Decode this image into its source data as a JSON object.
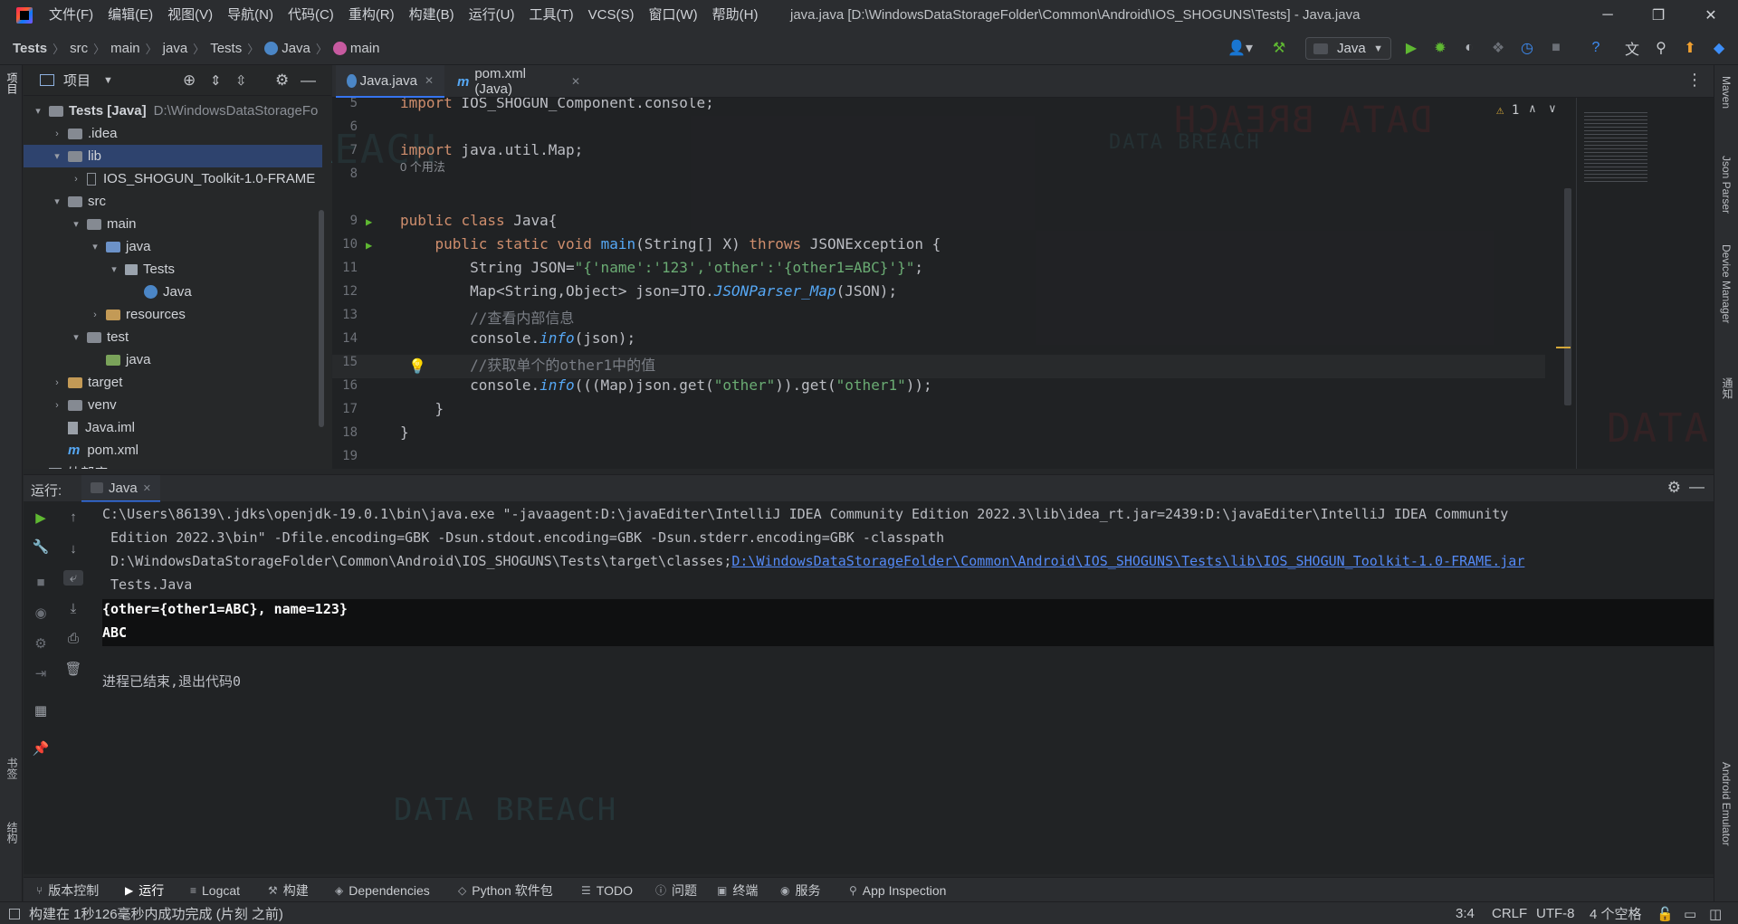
{
  "menu": [
    "文件(F)",
    "编辑(E)",
    "视图(V)",
    "导航(N)",
    "代码(C)",
    "重构(R)",
    "构建(B)",
    "运行(U)",
    "工具(T)",
    "VCS(S)",
    "窗口(W)",
    "帮助(H)"
  ],
  "window_title": "java.java [D:\\WindowsDataStorageFolder\\Common\\Android\\IOS_SHOGUNS\\Tests] - Java.java",
  "breadcrumb": [
    "Tests",
    "src",
    "main",
    "java",
    "Tests",
    "Java",
    "main"
  ],
  "run_config": "Java",
  "left_stripe": {
    "project": "项目",
    "bookmarks": "书签",
    "structure": "结构"
  },
  "right_stripe": [
    "Maven",
    "Json Parser",
    "Device Manager",
    "通知",
    "Android Emulator"
  ],
  "project_panel": {
    "title": "项目",
    "tree": [
      {
        "label": "Tests [Java]",
        "suffix": "D:\\WindowsDataStorageFo",
        "depth": 0,
        "arrow": "open",
        "icon": "folder-gray"
      },
      {
        "label": ".idea",
        "depth": 1,
        "arrow": "closed",
        "icon": "folder-gray"
      },
      {
        "label": "lib",
        "depth": 1,
        "arrow": "open",
        "icon": "folder-gray"
      },
      {
        "label": "IOS_SHOGUN_Toolkit-1.0-FRAME",
        "depth": 2,
        "arrow": "closed",
        "icon": "jar-icon"
      },
      {
        "label": "src",
        "depth": 1,
        "arrow": "open",
        "icon": "folder-gray"
      },
      {
        "label": "main",
        "depth": 2,
        "arrow": "open",
        "icon": "folder-gray"
      },
      {
        "label": "java",
        "depth": 3,
        "arrow": "open",
        "icon": "folder-blue"
      },
      {
        "label": "Tests",
        "depth": 4,
        "arrow": "open",
        "icon": "package-icon"
      },
      {
        "label": "Java",
        "depth": 5,
        "arrow": "none",
        "icon": "class-icon"
      },
      {
        "label": "resources",
        "depth": 3,
        "arrow": "closed",
        "icon": "folder-orange"
      },
      {
        "label": "test",
        "depth": 2,
        "arrow": "open",
        "icon": "folder-gray"
      },
      {
        "label": "java",
        "depth": 3,
        "arrow": "none",
        "icon": "folder-green"
      },
      {
        "label": "target",
        "depth": 1,
        "arrow": "closed",
        "icon": "folder-orange"
      },
      {
        "label": "venv",
        "depth": 1,
        "arrow": "closed",
        "icon": "folder-gray"
      },
      {
        "label": "Java.iml",
        "depth": 1,
        "arrow": "none",
        "icon": "iml-icon"
      },
      {
        "label": "pom.xml",
        "depth": 1,
        "arrow": "none",
        "icon": "maven-icon"
      },
      {
        "label": "外部库",
        "depth": 0,
        "arrow": "closed",
        "icon": "library-icon"
      }
    ]
  },
  "editor_tabs": [
    {
      "label": "Java.java",
      "active": true,
      "icon": "class-icon"
    },
    {
      "label": "pom.xml (Java)",
      "active": false,
      "icon": "maven-icon"
    }
  ],
  "editor": {
    "warnings": "1",
    "usages_hint": "0 个用法",
    "lines": [
      {
        "num": "5",
        "code": "import IOS_SHOGUN_Component.console;"
      },
      {
        "num": "6",
        "code": ""
      },
      {
        "num": "7",
        "code": "import java.util.Map;"
      },
      {
        "num": "8",
        "code": ""
      },
      {
        "num": "9",
        "code": "public class Java{"
      },
      {
        "num": "10",
        "code": "    public static void main(String[] X) throws JSONException {"
      },
      {
        "num": "11",
        "code": "        String JSON=\"{'name':'123','other':'{other1=ABC}'}\";"
      },
      {
        "num": "12",
        "code": "        Map<String,Object> json=JTO.JSONParser_Map(JSON);"
      },
      {
        "num": "13",
        "code": "        //查看内部信息"
      },
      {
        "num": "14",
        "code": "        console.info(json);"
      },
      {
        "num": "15",
        "code": "        //获取单个的other1中的值"
      },
      {
        "num": "16",
        "code": "        console.info(((Map)json.get(\"other\")).get(\"other1\"));"
      },
      {
        "num": "17",
        "code": "    }"
      },
      {
        "num": "18",
        "code": "}"
      },
      {
        "num": "19",
        "code": ""
      }
    ]
  },
  "run_panel": {
    "label": "运行:",
    "tab": "Java",
    "console": [
      "C:\\Users\\86139\\.jdks\\openjdk-19.0.1\\bin\\java.exe \"-javaagent:D:\\javaEditer\\IntelliJ IDEA Community Edition 2022.3\\lib\\idea_rt.jar=2439:D:\\javaEditer\\IntelliJ IDEA Community",
      " Edition 2022.3\\bin\" -Dfile.encoding=GBK -Dsun.stdout.encoding=GBK -Dsun.stderr.encoding=GBK -classpath",
      " D:\\WindowsDataStorageFolder\\Common\\Android\\IOS_SHOGUNS\\Tests\\target\\classes;",
      " Tests.Java",
      "{other={other1=ABC}, name=123}",
      "ABC",
      "进程已结束,退出代码0"
    ],
    "console_link": "D:\\WindowsDataStorageFolder\\Common\\Android\\IOS_SHOGUNS\\Tests\\lib\\IOS_SHOGUN_Toolkit-1.0-FRAME.jar"
  },
  "tool_window_bar": [
    {
      "label": "版本控制",
      "icon": "vcs-icon"
    },
    {
      "label": "运行",
      "icon": "run-icon"
    },
    {
      "label": "Logcat",
      "icon": "logcat-icon"
    },
    {
      "label": "构建",
      "icon": "build-icon"
    },
    {
      "label": "Dependencies",
      "icon": "dependencies-icon"
    },
    {
      "label": "Python 软件包",
      "icon": "python-packages-icon"
    },
    {
      "label": "TODO",
      "icon": "todo-icon"
    },
    {
      "label": "问题",
      "icon": "problems-icon"
    },
    {
      "label": "终端",
      "icon": "terminal-icon"
    },
    {
      "label": "服务",
      "icon": "services-icon"
    },
    {
      "label": "App Inspection",
      "icon": "app-inspection-icon"
    }
  ],
  "status_bar": {
    "message": "构建在 1秒126毫秒内成功完成 (片刻 之前)",
    "position": "3:4",
    "line_separator": "CRLF",
    "encoding": "UTF-8",
    "indent": "4 个空格"
  },
  "colors": {
    "accent": "#548af7",
    "run_green": "#5fb832",
    "keyword": "#cf8e6d",
    "string": "#6aab73",
    "function": "#56a8f5"
  }
}
